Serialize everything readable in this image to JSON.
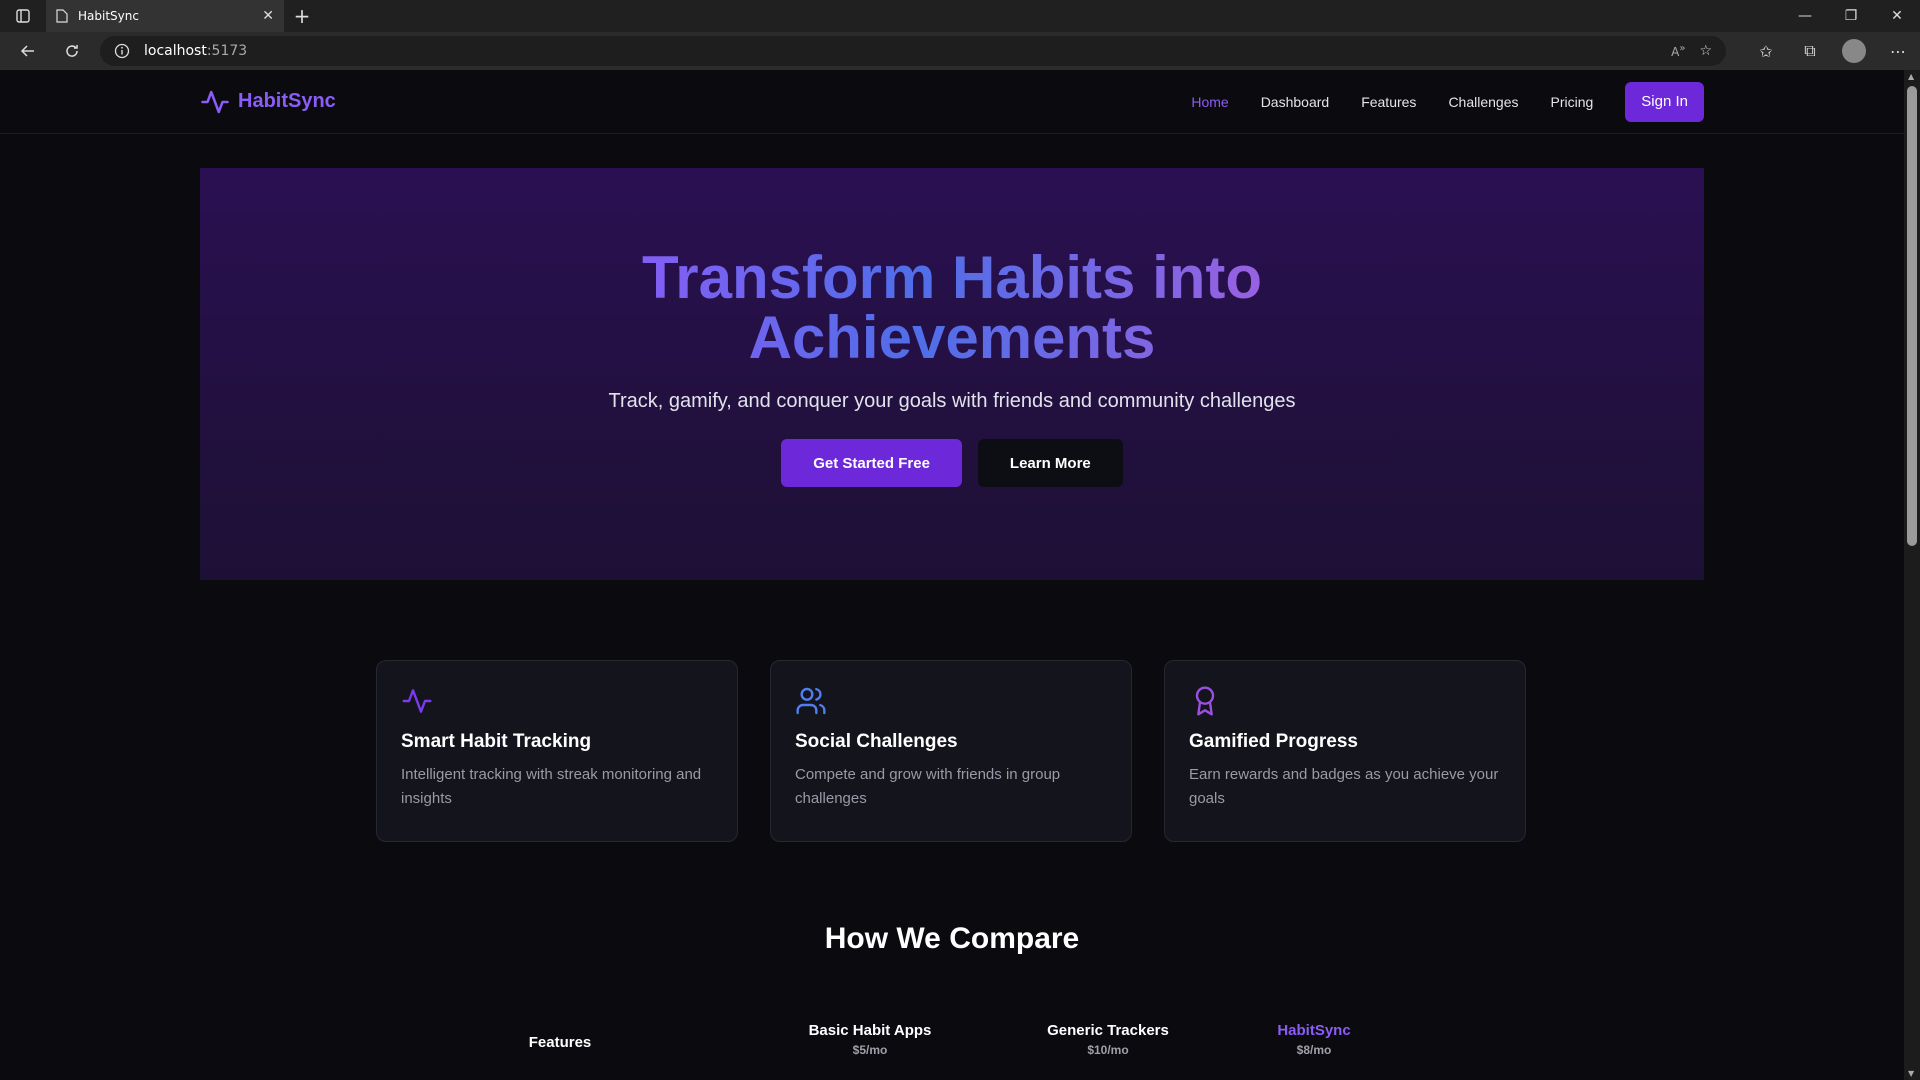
{
  "browser": {
    "tab_title": "HabitSync",
    "url_host": "localhost",
    "url_port": ":5173"
  },
  "header": {
    "logo_text": "HabitSync",
    "nav": [
      "Home",
      "Dashboard",
      "Features",
      "Challenges",
      "Pricing"
    ],
    "active_nav": "Home",
    "signin_label": "Sign In"
  },
  "hero": {
    "title_line1": "Transform Habits into",
    "title_line2": "Achievements",
    "subtitle": "Track, gamify, and conquer your goals with friends and community challenges",
    "primary_cta": "Get Started Free",
    "secondary_cta": "Learn More"
  },
  "features": [
    {
      "icon": "activity-icon",
      "title": "Smart Habit Tracking",
      "desc": "Intelligent tracking with streak monitoring and insights"
    },
    {
      "icon": "users-icon",
      "title": "Social Challenges",
      "desc": "Compete and grow with friends in group challenges"
    },
    {
      "icon": "award-icon",
      "title": "Gamified Progress",
      "desc": "Earn rewards and badges as you achieve your goals"
    }
  ],
  "compare": {
    "title": "How We Compare",
    "features_label": "Features",
    "columns": [
      {
        "name": "Basic Habit Apps",
        "price": "$5/mo"
      },
      {
        "name": "Generic Trackers",
        "price": "$10/mo"
      },
      {
        "name": "HabitSync",
        "price": "$8/mo"
      }
    ]
  },
  "colors": {
    "accent": "#6d28d9",
    "brand": "#8b5cf6",
    "background": "#0a0a0f",
    "card": "#14141c"
  }
}
